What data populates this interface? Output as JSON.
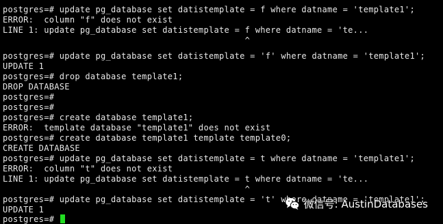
{
  "terminal": {
    "lines": [
      "postgres=# update pg_database set datistemplate = f where datname = 'template1';",
      "ERROR:  column \"f\" does not exist",
      "LINE 1: update pg_database set datistemplate = f where datname = 'te...",
      "                                               ^",
      "",
      "postgres=# update pg_database set datistemplate = 'f' where datname = 'template1';",
      "UPDATE 1",
      "postgres=# drop database template1;",
      "DROP DATABASE",
      "postgres=#",
      "postgres=#",
      "postgres=# create database template1;",
      "ERROR:  template database \"template1\" does not exist",
      "postgres=# create database template1 template template0;",
      "CREATE DATABASE",
      "postgres=# update pg_database set datistemplate = t where datname = 'template1';",
      "ERROR:  column \"t\" does not exist",
      "LINE 1: update pg_database set datistemplate = t where datname = 'te...",
      "                                               ^",
      "",
      "postgres=# update pg_database set datistemplate = 't' where datname = 'template1';",
      "UPDATE 1",
      "postgres=# "
    ],
    "cursor_color": "#22dd22",
    "text_color": "#e8e8e8",
    "background_color": "#000000"
  },
  "watermark": {
    "icon": "wechat-icon",
    "text": "微信号: AustinDatabases"
  }
}
